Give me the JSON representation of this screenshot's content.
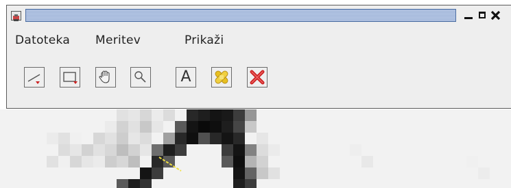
{
  "window": {
    "title": "",
    "controls": {
      "minimize_icon": "minimize-icon",
      "maximize_icon": "maximize-icon",
      "close_icon": "close-icon"
    }
  },
  "menu": {
    "items": [
      {
        "label": "Datoteka"
      },
      {
        "label": "Meritev"
      },
      {
        "label": "Prikaži"
      }
    ]
  },
  "toolbar": {
    "tools": [
      {
        "icon": "line-tool-icon"
      },
      {
        "icon": "rectangle-tool-icon"
      },
      {
        "icon": "hand-pan-icon"
      },
      {
        "icon": "zoom-magnifier-icon"
      },
      {
        "icon": "text-tool-icon",
        "label": "A"
      },
      {
        "icon": "clear-bandage-icon"
      },
      {
        "icon": "delete-x-icon"
      }
    ]
  },
  "colors": {
    "title_bar_fill": "#9fb4d8",
    "window_bg": "#eeeeee",
    "accent_red": "#cc2222",
    "accent_yellow": "#e8c020",
    "measure_line": "#f0e040"
  }
}
